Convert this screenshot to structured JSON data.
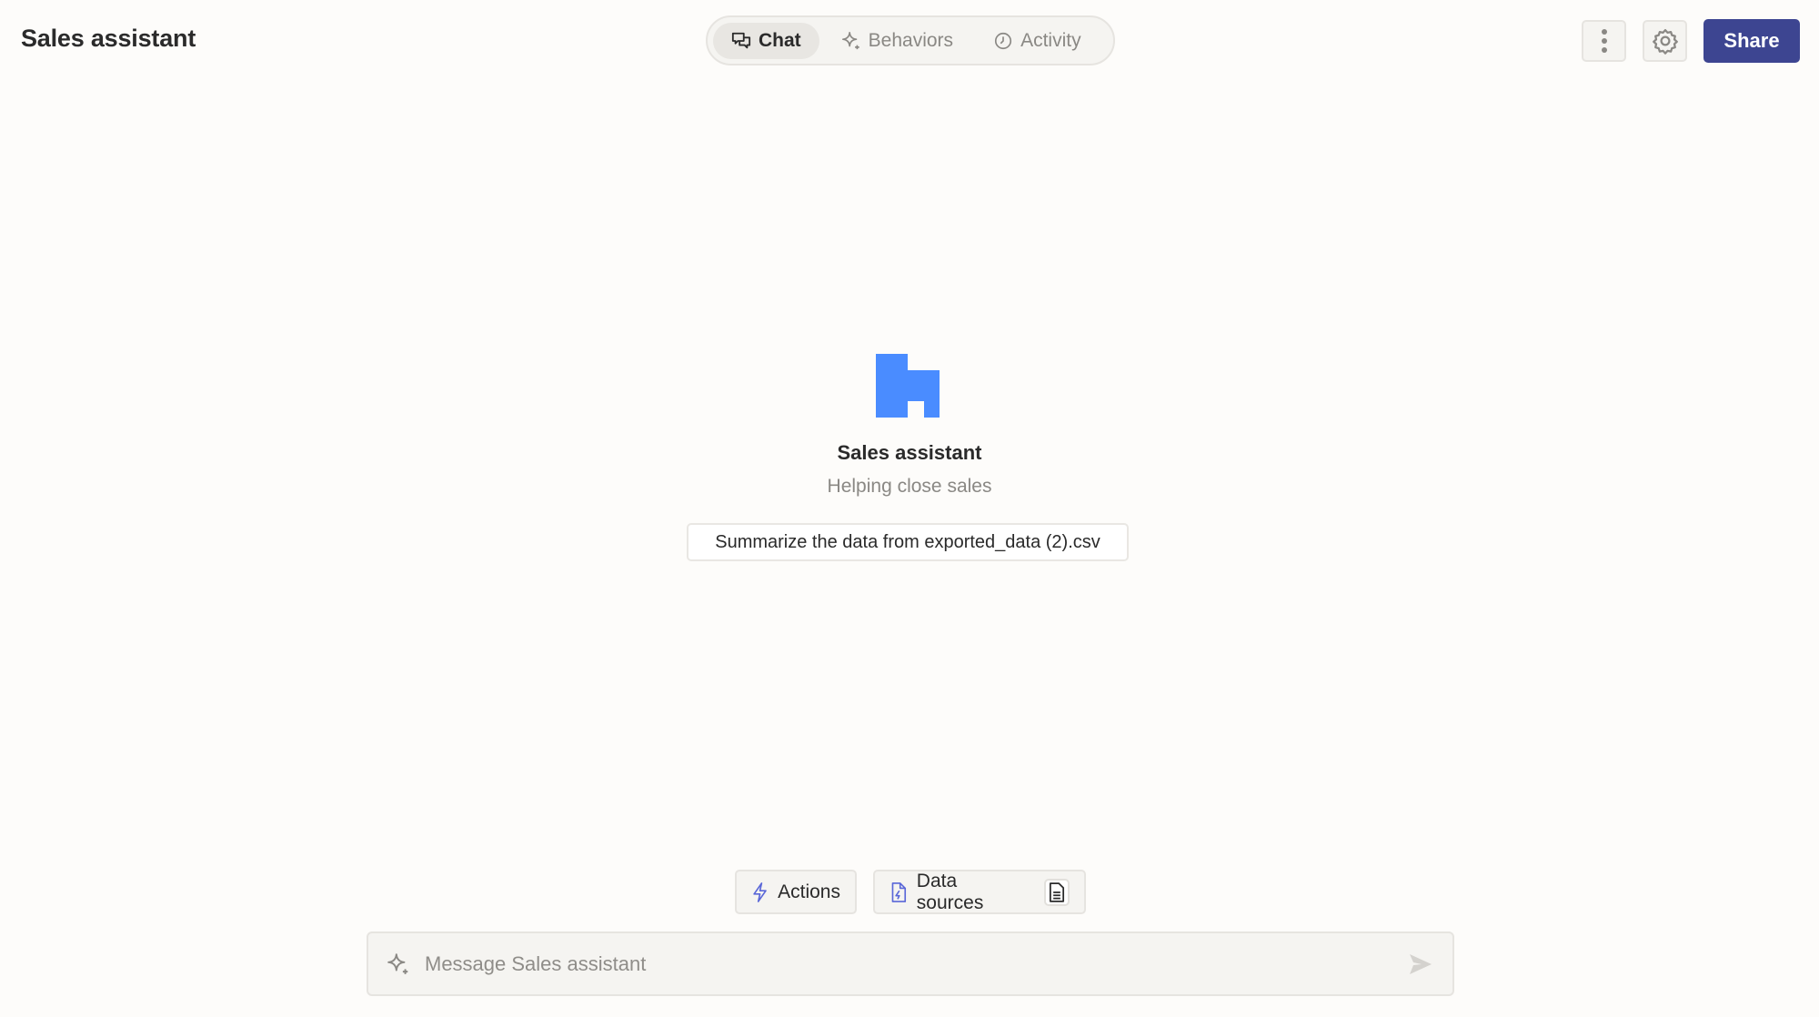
{
  "header": {
    "title": "Sales assistant",
    "tabs": [
      {
        "label": "Chat",
        "icon": "chat-bubbles-icon",
        "active": true
      },
      {
        "label": "Behaviors",
        "icon": "sparkle-icon",
        "active": false
      },
      {
        "label": "Activity",
        "icon": "clock-icon",
        "active": false
      }
    ],
    "more_icon": "kebab-icon",
    "settings_icon": "gear-icon",
    "share_label": "Share"
  },
  "agent": {
    "name": "Sales assistant",
    "description": "Helping close sales",
    "logo_color": "#4a8cff",
    "suggestion": "Summarize the data from exported_data (2).csv"
  },
  "composer": {
    "actions_label": "Actions",
    "data_sources_label": "Data sources",
    "placeholder": "Message Sales assistant",
    "value": ""
  },
  "colors": {
    "accent": "#3d4591",
    "icon_accent": "#5a67d8",
    "background": "#fdfcfa"
  }
}
